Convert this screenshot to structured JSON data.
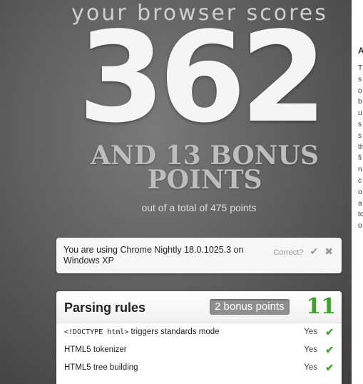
{
  "score": {
    "header": "your browser scores",
    "points": "362",
    "bonus_line1": "AND 13 BONUS",
    "bonus_line2": "POINTS",
    "total_text": "out of a total of 475 points"
  },
  "browser": {
    "info": "You are using Chrome Nightly 18.0.1025.3 on Windows XP",
    "correct_label": "Correct?",
    "confirm_icon": "check-icon",
    "reject_icon": "close-icon"
  },
  "section": {
    "title": "Parsing rules",
    "bonus": "2 bonus points",
    "score": "11",
    "rows": [
      {
        "code": "<!DOCTYPE html>",
        "label": " triggers standards mode",
        "result": "Yes"
      },
      {
        "code": "",
        "label": "HTML5 tokenizer",
        "result": "Yes"
      },
      {
        "code": "",
        "label": "HTML5 tree building",
        "result": "Yes"
      }
    ]
  },
  "right_column": {
    "head": "A",
    "letters": [
      "T",
      "s",
      "o",
      "b",
      "u",
      "s",
      "s",
      "th",
      "fi",
      "n",
      "c",
      "o",
      "a",
      "to",
      "o"
    ]
  },
  "colors": {
    "accent_green": "#3ea32b",
    "badge_grey": "#8f8f8f",
    "background": "#5f5f5f"
  }
}
